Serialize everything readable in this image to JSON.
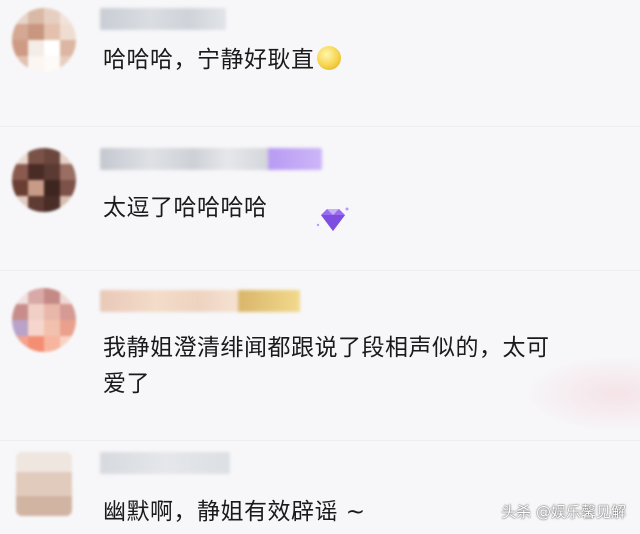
{
  "comments": [
    {
      "text": "哈哈哈，宁静好耿直",
      "emoji": "smirk-emoji"
    },
    {
      "text": "太逗了哈哈哈哈",
      "sticker": "purple-diamond-sticker"
    },
    {
      "text_line1": "我静姐澄清绯闻都跟说了段相声似的，太可",
      "text_line2": "爱了"
    },
    {
      "text": "幽默啊，静姐有效辟谣 ~"
    }
  ],
  "watermark": "头杀 @娱乐馨见解",
  "colors": {
    "background": "#f7f7f9",
    "text": "#1a1a1a",
    "sticker": "#9b6cf0"
  }
}
